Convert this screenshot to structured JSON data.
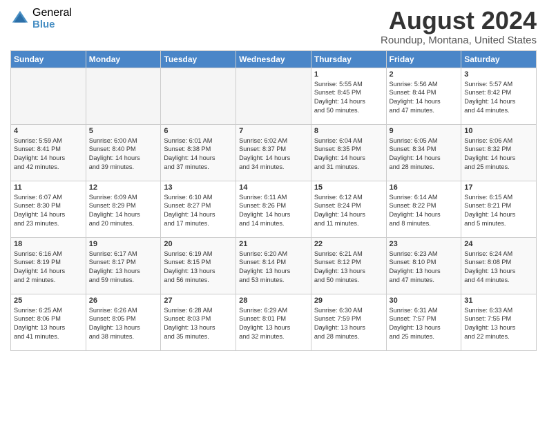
{
  "header": {
    "logo_general": "General",
    "logo_blue": "Blue",
    "main_title": "August 2024",
    "subtitle": "Roundup, Montana, United States"
  },
  "calendar": {
    "days_of_week": [
      "Sunday",
      "Monday",
      "Tuesday",
      "Wednesday",
      "Thursday",
      "Friday",
      "Saturday"
    ],
    "weeks": [
      [
        {
          "day": "",
          "info": ""
        },
        {
          "day": "",
          "info": ""
        },
        {
          "day": "",
          "info": ""
        },
        {
          "day": "",
          "info": ""
        },
        {
          "day": "1",
          "info": "Sunrise: 5:55 AM\nSunset: 8:45 PM\nDaylight: 14 hours\nand 50 minutes."
        },
        {
          "day": "2",
          "info": "Sunrise: 5:56 AM\nSunset: 8:44 PM\nDaylight: 14 hours\nand 47 minutes."
        },
        {
          "day": "3",
          "info": "Sunrise: 5:57 AM\nSunset: 8:42 PM\nDaylight: 14 hours\nand 44 minutes."
        }
      ],
      [
        {
          "day": "4",
          "info": "Sunrise: 5:59 AM\nSunset: 8:41 PM\nDaylight: 14 hours\nand 42 minutes."
        },
        {
          "day": "5",
          "info": "Sunrise: 6:00 AM\nSunset: 8:40 PM\nDaylight: 14 hours\nand 39 minutes."
        },
        {
          "day": "6",
          "info": "Sunrise: 6:01 AM\nSunset: 8:38 PM\nDaylight: 14 hours\nand 37 minutes."
        },
        {
          "day": "7",
          "info": "Sunrise: 6:02 AM\nSunset: 8:37 PM\nDaylight: 14 hours\nand 34 minutes."
        },
        {
          "day": "8",
          "info": "Sunrise: 6:04 AM\nSunset: 8:35 PM\nDaylight: 14 hours\nand 31 minutes."
        },
        {
          "day": "9",
          "info": "Sunrise: 6:05 AM\nSunset: 8:34 PM\nDaylight: 14 hours\nand 28 minutes."
        },
        {
          "day": "10",
          "info": "Sunrise: 6:06 AM\nSunset: 8:32 PM\nDaylight: 14 hours\nand 25 minutes."
        }
      ],
      [
        {
          "day": "11",
          "info": "Sunrise: 6:07 AM\nSunset: 8:30 PM\nDaylight: 14 hours\nand 23 minutes."
        },
        {
          "day": "12",
          "info": "Sunrise: 6:09 AM\nSunset: 8:29 PM\nDaylight: 14 hours\nand 20 minutes."
        },
        {
          "day": "13",
          "info": "Sunrise: 6:10 AM\nSunset: 8:27 PM\nDaylight: 14 hours\nand 17 minutes."
        },
        {
          "day": "14",
          "info": "Sunrise: 6:11 AM\nSunset: 8:26 PM\nDaylight: 14 hours\nand 14 minutes."
        },
        {
          "day": "15",
          "info": "Sunrise: 6:12 AM\nSunset: 8:24 PM\nDaylight: 14 hours\nand 11 minutes."
        },
        {
          "day": "16",
          "info": "Sunrise: 6:14 AM\nSunset: 8:22 PM\nDaylight: 14 hours\nand 8 minutes."
        },
        {
          "day": "17",
          "info": "Sunrise: 6:15 AM\nSunset: 8:21 PM\nDaylight: 14 hours\nand 5 minutes."
        }
      ],
      [
        {
          "day": "18",
          "info": "Sunrise: 6:16 AM\nSunset: 8:19 PM\nDaylight: 14 hours\nand 2 minutes."
        },
        {
          "day": "19",
          "info": "Sunrise: 6:17 AM\nSunset: 8:17 PM\nDaylight: 13 hours\nand 59 minutes."
        },
        {
          "day": "20",
          "info": "Sunrise: 6:19 AM\nSunset: 8:15 PM\nDaylight: 13 hours\nand 56 minutes."
        },
        {
          "day": "21",
          "info": "Sunrise: 6:20 AM\nSunset: 8:14 PM\nDaylight: 13 hours\nand 53 minutes."
        },
        {
          "day": "22",
          "info": "Sunrise: 6:21 AM\nSunset: 8:12 PM\nDaylight: 13 hours\nand 50 minutes."
        },
        {
          "day": "23",
          "info": "Sunrise: 6:23 AM\nSunset: 8:10 PM\nDaylight: 13 hours\nand 47 minutes."
        },
        {
          "day": "24",
          "info": "Sunrise: 6:24 AM\nSunset: 8:08 PM\nDaylight: 13 hours\nand 44 minutes."
        }
      ],
      [
        {
          "day": "25",
          "info": "Sunrise: 6:25 AM\nSunset: 8:06 PM\nDaylight: 13 hours\nand 41 minutes."
        },
        {
          "day": "26",
          "info": "Sunrise: 6:26 AM\nSunset: 8:05 PM\nDaylight: 13 hours\nand 38 minutes."
        },
        {
          "day": "27",
          "info": "Sunrise: 6:28 AM\nSunset: 8:03 PM\nDaylight: 13 hours\nand 35 minutes."
        },
        {
          "day": "28",
          "info": "Sunrise: 6:29 AM\nSunset: 8:01 PM\nDaylight: 13 hours\nand 32 minutes."
        },
        {
          "day": "29",
          "info": "Sunrise: 6:30 AM\nSunset: 7:59 PM\nDaylight: 13 hours\nand 28 minutes."
        },
        {
          "day": "30",
          "info": "Sunrise: 6:31 AM\nSunset: 7:57 PM\nDaylight: 13 hours\nand 25 minutes."
        },
        {
          "day": "31",
          "info": "Sunrise: 6:33 AM\nSunset: 7:55 PM\nDaylight: 13 hours\nand 22 minutes."
        }
      ]
    ]
  }
}
